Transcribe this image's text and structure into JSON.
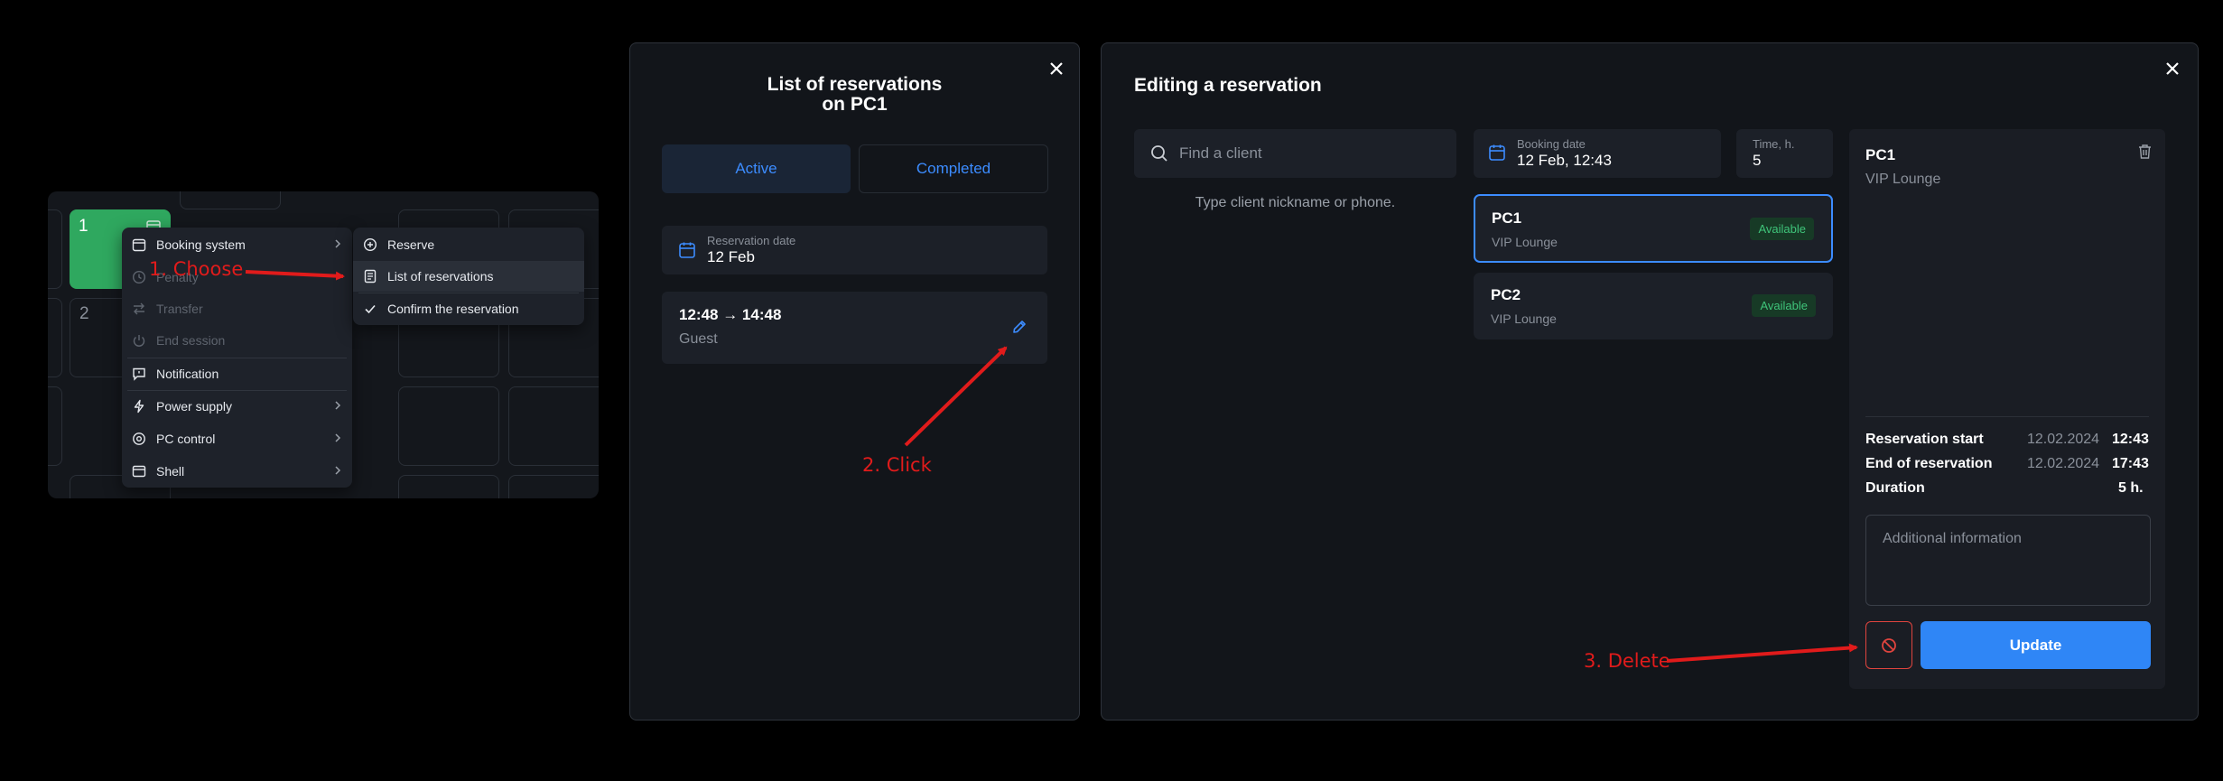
{
  "grid": {
    "pc1_number": "1",
    "pc2_number": "2",
    "context_menu": {
      "items": [
        {
          "label": "Booking system",
          "icon": "calendar-icon",
          "disabled": false,
          "has_submenu": true
        },
        {
          "label": "Penalty",
          "icon": "clock-icon",
          "disabled": true,
          "has_submenu": false
        },
        {
          "label": "Transfer",
          "icon": "transfer-icon",
          "disabled": true,
          "has_submenu": false
        },
        {
          "label": "End session",
          "icon": "power-off-icon",
          "disabled": true,
          "has_submenu": false
        },
        {
          "label": "Notification",
          "icon": "message-icon",
          "disabled": false,
          "has_submenu": false
        },
        {
          "label": "Power supply",
          "icon": "lightning-icon",
          "disabled": false,
          "has_submenu": true
        },
        {
          "label": "PC control",
          "icon": "gear-icon",
          "disabled": false,
          "has_submenu": true
        },
        {
          "label": "Shell",
          "icon": "window-icon",
          "disabled": false,
          "has_submenu": true
        }
      ]
    },
    "submenu": {
      "items": [
        {
          "label": "Reserve",
          "icon": "plus-circle-icon"
        },
        {
          "label": "List of reservations",
          "icon": "list-icon"
        },
        {
          "label": "Confirm the reservation",
          "icon": "check-icon"
        }
      ]
    }
  },
  "list_modal": {
    "title_line1": "List of reservations",
    "title_line2": "on PC1",
    "tabs": [
      {
        "label": "Active",
        "active": true
      },
      {
        "label": "Completed",
        "active": false
      }
    ],
    "reservation_date_label": "Reservation date",
    "reservation_date_value": "12 Feb",
    "reservation": {
      "time": "12:48 → 14:48",
      "client": "Guest"
    }
  },
  "edit_modal": {
    "title": "Editing a reservation",
    "search_placeholder": "Find a client",
    "search_hint": "Type client nickname or phone.",
    "booking_date_label": "Booking date",
    "booking_date_value": "12 Feb, 12:43",
    "time_label": "Time, h.",
    "time_value": "5",
    "pcs": [
      {
        "name": "PC1",
        "zone": "VIP Lounge",
        "status": "Available",
        "selected": true
      },
      {
        "name": "PC2",
        "zone": "VIP Lounge",
        "status": "Available",
        "selected": false
      }
    ],
    "selected_pc": {
      "name": "PC1",
      "zone": "VIP Lounge"
    },
    "summary": {
      "start_label": "Reservation start",
      "start_date": "12.02.2024",
      "start_time": "12:43",
      "end_label": "End of reservation",
      "end_date": "12.02.2024",
      "end_time": "17:43",
      "duration_label": "Duration",
      "duration_value": "5 h."
    },
    "additional_info_placeholder": "Additional information",
    "update_label": "Update"
  },
  "annotations": {
    "step1": "1. Choose",
    "step2": "2. Click",
    "step3": "3. Delete"
  },
  "colors": {
    "accent": "#2f86f6",
    "available": "#3fc47a",
    "pc_busy": "#2fa85f",
    "annotation": "#e11b1b",
    "danger": "#e0443e"
  }
}
